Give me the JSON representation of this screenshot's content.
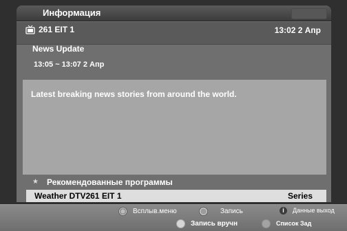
{
  "header": {
    "title": "Информация"
  },
  "channel": {
    "number_label": "261 EIT 1",
    "datetime": "13:02 2 Апр"
  },
  "program": {
    "title": "News Update",
    "time_range": "13:05 ~ 13:07 2 Апр",
    "description": "Latest breaking news stories from around the world."
  },
  "recommended": {
    "heading": "Рекомендованные программы",
    "items": [
      {
        "name": "Weather DTV261 EIT 1",
        "tag": "Series"
      }
    ]
  },
  "footer": {
    "popup_menu": "Всплыв.меню",
    "record": "Запись",
    "info_exit": "Данные выход",
    "manual_record": "Запись вручн",
    "schedule_list": "Список Зад"
  },
  "colors": {
    "panel_bg": "#6f6f6f",
    "desc_bg": "#a6a6a6",
    "selected_row_bg": "#dedede"
  }
}
